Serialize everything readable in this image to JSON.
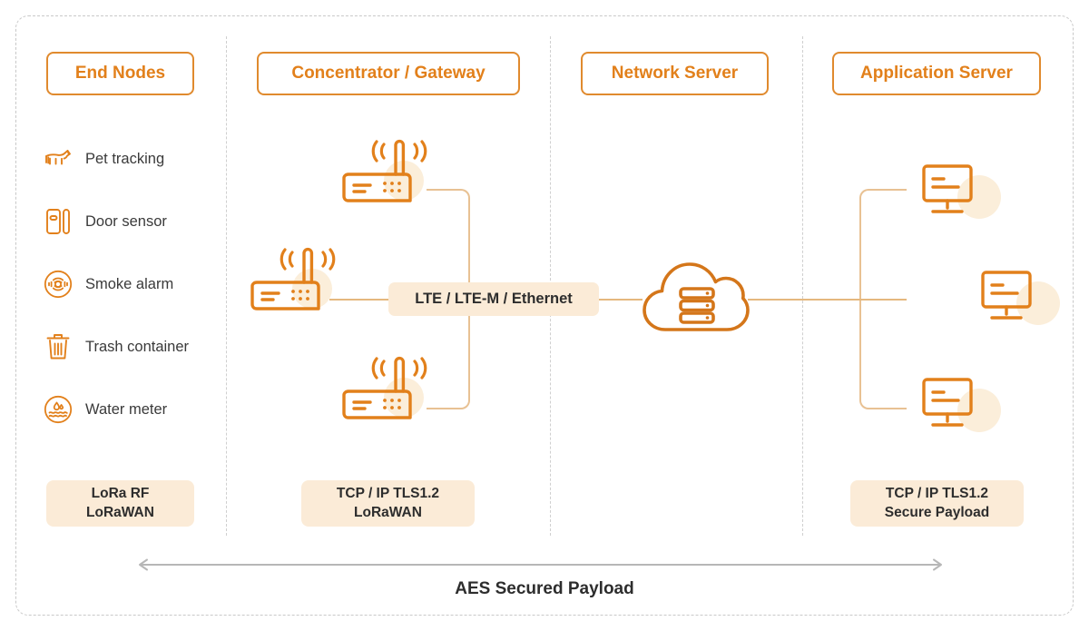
{
  "columns": [
    {
      "id": "end-nodes",
      "title": "End Nodes"
    },
    {
      "id": "concentrator",
      "title": "Concentrator / Gateway"
    },
    {
      "id": "network-server",
      "title": "Network Server"
    },
    {
      "id": "application-server",
      "title": "Application Server"
    }
  ],
  "end_nodes": [
    {
      "icon": "dog-icon",
      "label": "Pet tracking"
    },
    {
      "icon": "door-sensor-icon",
      "label": "Door sensor"
    },
    {
      "icon": "smoke-alarm-icon",
      "label": "Smoke alarm"
    },
    {
      "icon": "trash-container-icon",
      "label": "Trash container"
    },
    {
      "icon": "water-meter-icon",
      "label": "Water meter"
    }
  ],
  "gateways": [
    {
      "icon": "router-gateway-icon",
      "position": "top"
    },
    {
      "icon": "router-gateway-icon",
      "position": "middle"
    },
    {
      "icon": "router-gateway-icon",
      "position": "bottom"
    }
  ],
  "network_server": {
    "icon": "cloud-server-icon"
  },
  "application_servers": [
    {
      "icon": "monitor-icon",
      "position": "top"
    },
    {
      "icon": "monitor-icon",
      "position": "middle"
    },
    {
      "icon": "monitor-icon",
      "position": "bottom"
    }
  ],
  "link_label": {
    "text": "LTE / LTE-M / Ethernet"
  },
  "protocol_chips": [
    {
      "id": "lora-chip",
      "line1": "LoRa RF",
      "line2": "LoRaWAN"
    },
    {
      "id": "gateway-chip",
      "line1": "TCP / IP TLS1.2",
      "line2": "LoRaWAN"
    },
    {
      "id": "appserver-chip",
      "line1": "TCP / IP TLS1.2",
      "line2": "Secure Payload"
    }
  ],
  "footer": {
    "arrow_label": "AES Secured Payload"
  },
  "colors": {
    "accent_orange": "#e2801b",
    "header_border": "#e08a2e",
    "chip_bg": "#fbebd7",
    "line": "#e5b87e",
    "blob": "#fbeeda",
    "divider": "#cfcfcf",
    "text_dark": "#2d2d2d",
    "arrow_gray": "#b7b7b7"
  }
}
